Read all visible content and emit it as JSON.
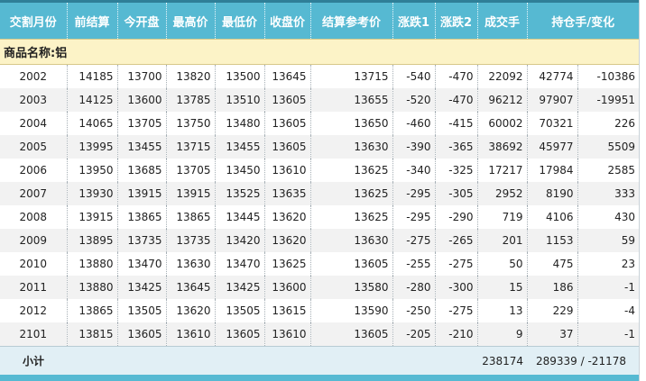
{
  "headers": [
    "交割月份",
    "前结算",
    "今开盘",
    "最高价",
    "最低价",
    "收盘价",
    "结算参考价",
    "涨跌1",
    "涨跌2",
    "成交手",
    "持仓手/变化"
  ],
  "section_label": "商品名称:铝",
  "rows": [
    [
      "2002",
      "14185",
      "13700",
      "13820",
      "13500",
      "13645",
      "13715",
      "-540",
      "-470",
      "22092",
      "42774",
      "-10386"
    ],
    [
      "2003",
      "14125",
      "13600",
      "13785",
      "13510",
      "13605",
      "13655",
      "-520",
      "-470",
      "96212",
      "97907",
      "-19951"
    ],
    [
      "2004",
      "14065",
      "13705",
      "13750",
      "13480",
      "13605",
      "13650",
      "-460",
      "-415",
      "60002",
      "70321",
      "226"
    ],
    [
      "2005",
      "13995",
      "13455",
      "13715",
      "13455",
      "13605",
      "13630",
      "-390",
      "-365",
      "38692",
      "45977",
      "5509"
    ],
    [
      "2006",
      "13950",
      "13685",
      "13705",
      "13450",
      "13610",
      "13625",
      "-340",
      "-325",
      "17217",
      "17984",
      "2585"
    ],
    [
      "2007",
      "13930",
      "13915",
      "13915",
      "13525",
      "13635",
      "13625",
      "-295",
      "-305",
      "2952",
      "8190",
      "333"
    ],
    [
      "2008",
      "13915",
      "13865",
      "13865",
      "13445",
      "13620",
      "13625",
      "-295",
      "-290",
      "719",
      "4106",
      "430"
    ],
    [
      "2009",
      "13895",
      "13735",
      "13735",
      "13420",
      "13620",
      "13630",
      "-275",
      "-265",
      "201",
      "1153",
      "59"
    ],
    [
      "2010",
      "13880",
      "13470",
      "13630",
      "13470",
      "13625",
      "13605",
      "-255",
      "-275",
      "50",
      "475",
      "23"
    ],
    [
      "2011",
      "13880",
      "13425",
      "13645",
      "13425",
      "13600",
      "13580",
      "-280",
      "-300",
      "15",
      "186",
      "-1"
    ],
    [
      "2012",
      "13865",
      "13505",
      "13620",
      "13505",
      "13615",
      "13590",
      "-250",
      "-275",
      "13",
      "229",
      "-4"
    ],
    [
      "2101",
      "13815",
      "13605",
      "13610",
      "13605",
      "13610",
      "13605",
      "-205",
      "-210",
      "9",
      "37",
      "-1"
    ]
  ],
  "total": {
    "label": "小计",
    "volume": "238174",
    "open_interest": "289339 / -21178"
  }
}
